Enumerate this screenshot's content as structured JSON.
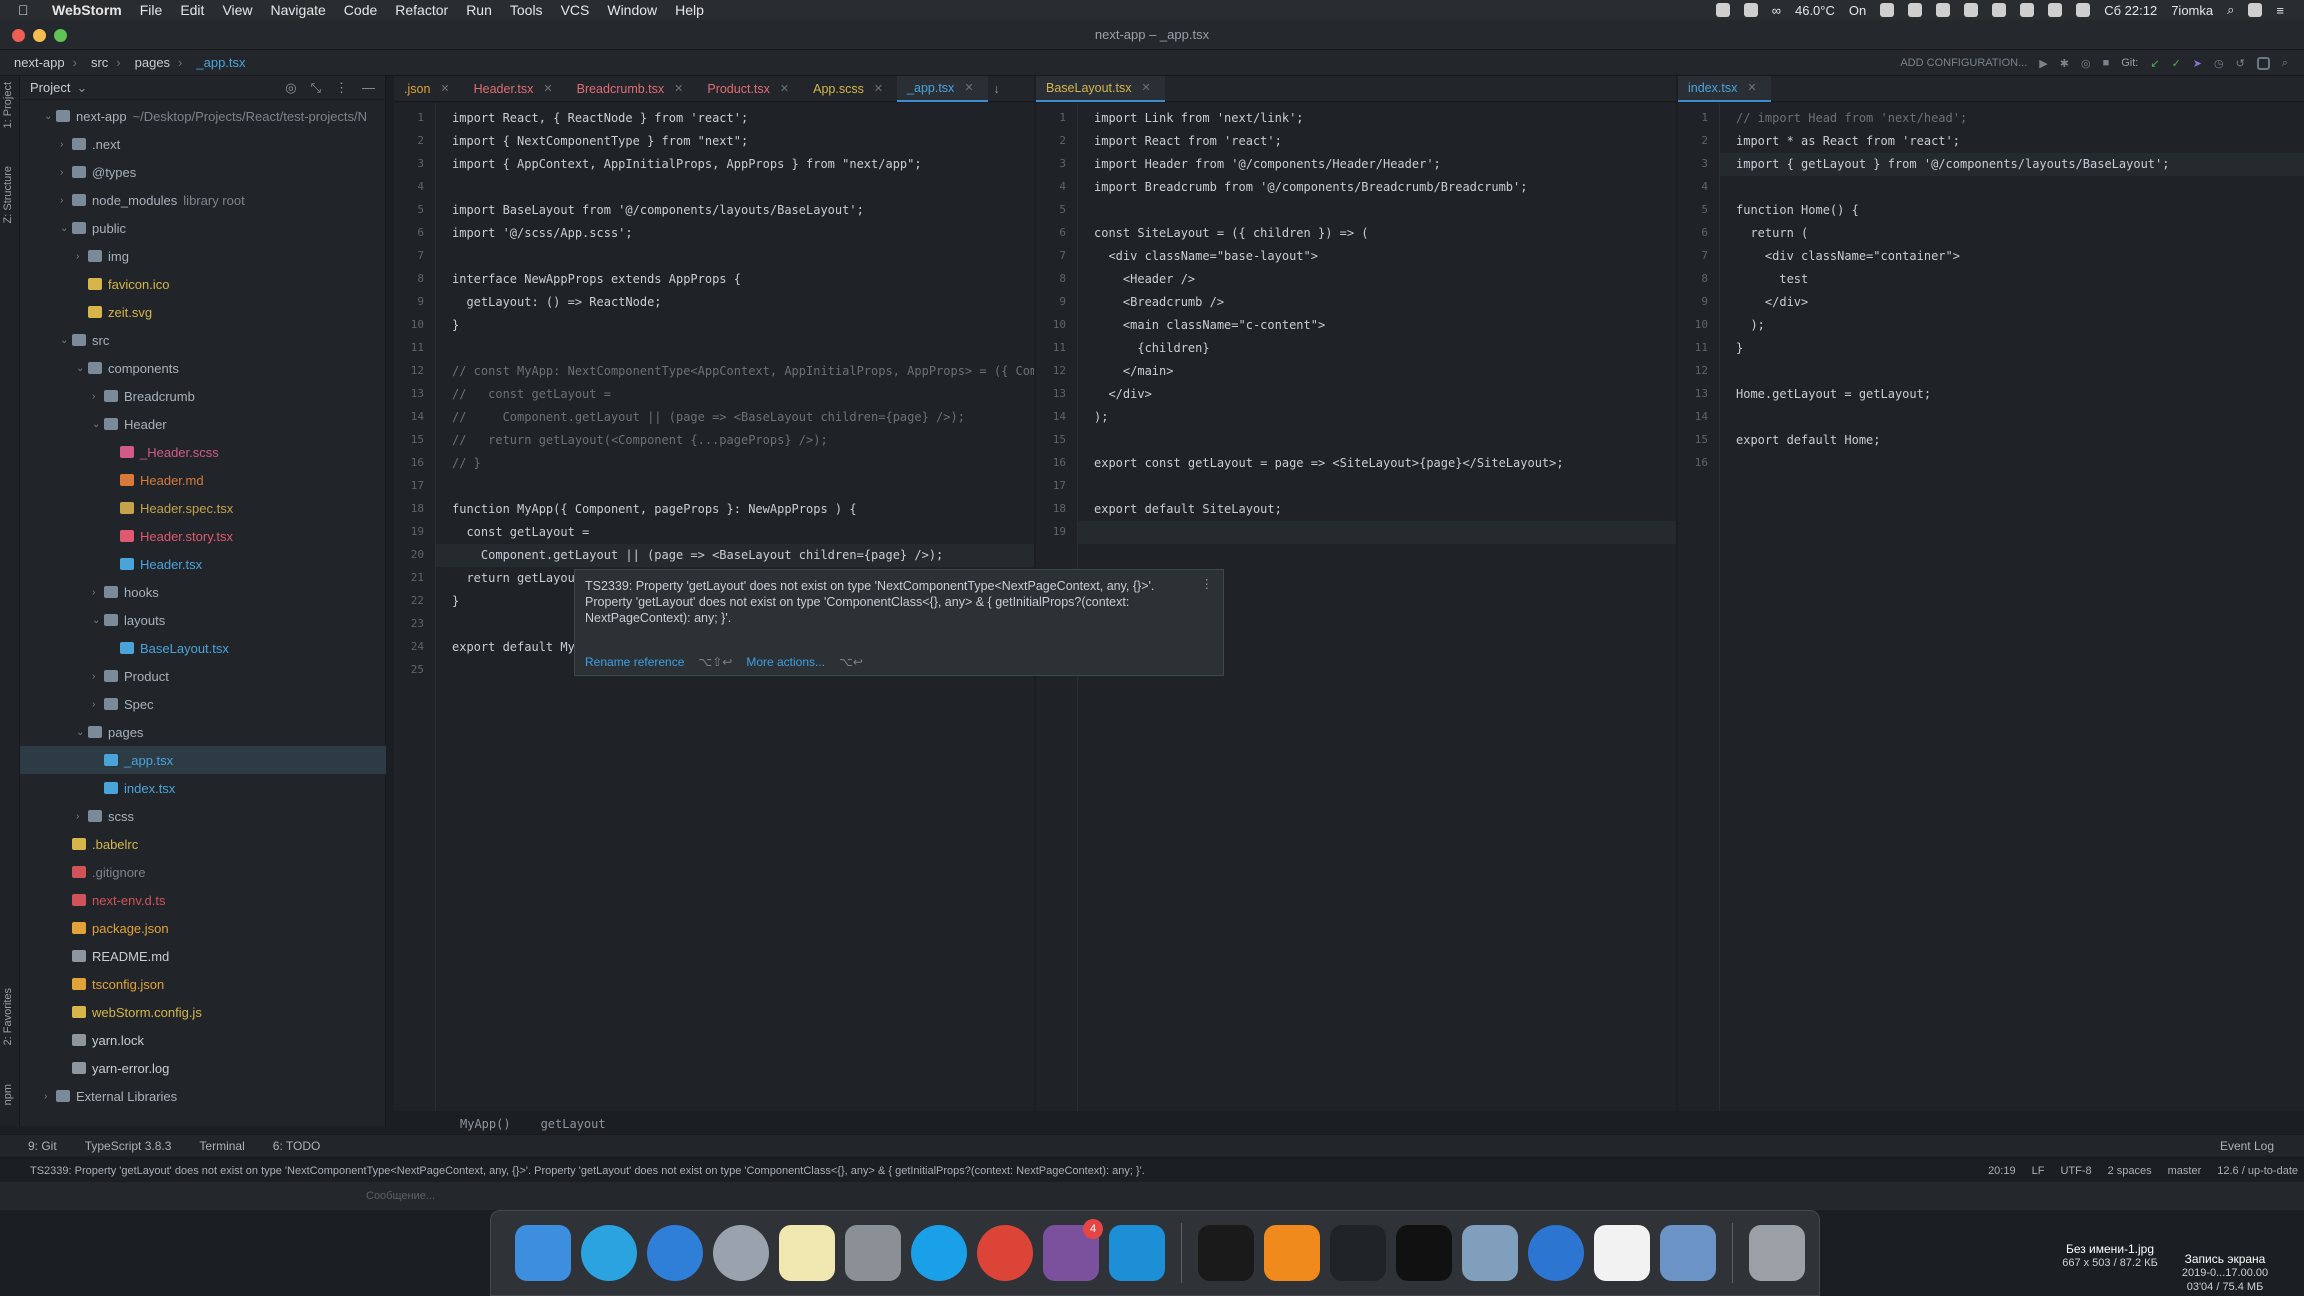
{
  "menubar": {
    "apple": "",
    "app": "WebStorm",
    "items": [
      "File",
      "Edit",
      "View",
      "Navigate",
      "Code",
      "Refactor",
      "Run",
      "Tools",
      "VCS",
      "Window",
      "Help"
    ],
    "status": {
      "temp": "46.0°C",
      "power": "On",
      "datetime": "Сб 22:12",
      "user": "7iomka"
    }
  },
  "window": {
    "title": "next-app – _app.tsx"
  },
  "navbar": {
    "crumbs": [
      "next-app",
      "src",
      "pages",
      "_app.tsx"
    ],
    "add_configuration": "ADD CONFIGURATION...",
    "git_label": "Git:"
  },
  "left_stripe": {
    "project": "1: Project",
    "structure": "Z: Structure",
    "favorites": "2: Favorites",
    "npm": "npm"
  },
  "project_panel": {
    "title": "Project",
    "root": "next-app",
    "root_path": "~/Desktop/Projects/React/test-projects/N",
    "items": [
      {
        "label": "next-app",
        "extra": "~/Desktop/Projects/React/test-projects/N",
        "type": "folder"
      },
      {
        "label": ".next",
        "type": "folder"
      },
      {
        "label": "@types",
        "type": "folder"
      },
      {
        "label": "node_modules",
        "extra": "library root",
        "type": "folder"
      },
      {
        "label": "public",
        "type": "folder"
      },
      {
        "label": "img",
        "type": "folder"
      },
      {
        "label": "favicon.ico",
        "type": "ico"
      },
      {
        "label": "zeit.svg",
        "type": "svg"
      },
      {
        "label": "src",
        "type": "folder"
      },
      {
        "label": "components",
        "type": "folder"
      },
      {
        "label": "Breadcrumb",
        "type": "folder"
      },
      {
        "label": "Header",
        "type": "folder"
      },
      {
        "label": "_Header.scss",
        "type": "scss"
      },
      {
        "label": "Header.md",
        "type": "md"
      },
      {
        "label": "Header.spec.tsx",
        "type": "spec"
      },
      {
        "label": "Header.story.tsx",
        "type": "story"
      },
      {
        "label": "Header.tsx",
        "type": "tsx"
      },
      {
        "label": "hooks",
        "type": "folder"
      },
      {
        "label": "layouts",
        "type": "folder"
      },
      {
        "label": "BaseLayout.tsx",
        "type": "tsx"
      },
      {
        "label": "Product",
        "type": "folder"
      },
      {
        "label": "Spec",
        "type": "folder"
      },
      {
        "label": "pages",
        "type": "folder"
      },
      {
        "label": "_app.tsx",
        "type": "tsx"
      },
      {
        "label": "index.tsx",
        "type": "tsx"
      },
      {
        "label": "scss",
        "type": "folder"
      },
      {
        "label": ".babelrc",
        "type": "yellow"
      },
      {
        "label": ".gitignore",
        "type": "dim"
      },
      {
        "label": "next-env.d.ts",
        "type": "red"
      },
      {
        "label": "package.json",
        "type": "json"
      },
      {
        "label": "README.md",
        "type": "white"
      },
      {
        "label": "tsconfig.json",
        "type": "json"
      },
      {
        "label": "webStorm.config.js",
        "type": "yellow"
      },
      {
        "label": "yarn.lock",
        "type": "white"
      },
      {
        "label": "yarn-error.log",
        "type": "white"
      },
      {
        "label": "External Libraries",
        "type": "folder"
      }
    ]
  },
  "tabs_left": [
    {
      "label": ".json",
      "active": false
    },
    {
      "label": "Header.tsx",
      "active": false
    },
    {
      "label": "Breadcrumb.tsx",
      "active": false
    },
    {
      "label": "Product.tsx",
      "active": false
    },
    {
      "label": "App.scss",
      "active": false
    },
    {
      "label": "_app.tsx",
      "active": true
    }
  ],
  "tabs_middle": [
    {
      "label": "BaseLayout.tsx",
      "active": true
    }
  ],
  "tabs_right": [
    {
      "label": "index.tsx",
      "active": true
    }
  ],
  "editor_left": {
    "lines": [
      "import React, { ReactNode } from 'react';",
      "import { NextComponentType } from \"next\";",
      "import { AppContext, AppInitialProps, AppProps } from \"next/app\";",
      "",
      "import BaseLayout from '@/components/layouts/BaseLayout';",
      "import '@/scss/App.scss';",
      "",
      "interface NewAppProps extends AppProps {",
      "  getLayout: () => ReactNode;",
      "}",
      "",
      "// const MyApp: NextComponentType<AppContext, AppInitialProps, AppProps> = ({ Compo",
      "//   const getLayout =",
      "//     Component.getLayout || (page => <BaseLayout children={page} />);",
      "//   return getLayout(<Component {...pageProps} />);",
      "// }",
      "",
      "function MyApp({ Component, pageProps }: NewAppProps ) {",
      "  const getLayout =",
      "    Component.getLayout || (page => <BaseLayout children={page} />);",
      "  return getLayou",
      "}",
      "",
      "export default My",
      ""
    ]
  },
  "editor_middle": {
    "lines": [
      "import Link from 'next/link';",
      "import React from 'react';",
      "import Header from '@/components/Header/Header';",
      "import Breadcrumb from '@/components/Breadcrumb/Breadcrumb';",
      "",
      "const SiteLayout = ({ children }) => (",
      "  <div className=\"base-layout\">",
      "    <Header />",
      "    <Breadcrumb />",
      "    <main className=\"c-content\">",
      "      {children}",
      "    </main>",
      "  </div>",
      ");",
      "",
      "export const getLayout = page => <SiteLayout>{page}</SiteLayout>;",
      "",
      "export default SiteLayout;",
      ""
    ]
  },
  "editor_right": {
    "lines": [
      "// import Head from 'next/head';",
      "import * as React from 'react';",
      "import { getLayout } from '@/components/layouts/BaseLayout';",
      "",
      "function Home() {",
      "  return (",
      "    <div className=\"container\">",
      "      test",
      "    </div>",
      "  );",
      "}",
      "",
      "Home.getLayout = getLayout;",
      "",
      "export default Home;",
      ""
    ]
  },
  "popup": {
    "message": "TS2339: Property 'getLayout' does not exist on type 'NextComponentType<NextPageContext, any, {}>'.\n  Property 'getLayout' does not exist on type 'ComponentClass<{}, any> & { getInitialProps?(context: NextPageContext): any; }'.",
    "action1": "Rename reference",
    "key1": "⌥⇧↩",
    "action2": "More actions...",
    "key2": "⌥↩"
  },
  "editor_breadcrumb": [
    "MyApp()",
    "getLayout"
  ],
  "toolwindows": {
    "git": "9: Git",
    "typescript": "TypeScript 3.8.3",
    "terminal": "Terminal",
    "todo": "6: TODO",
    "event_log": "Event Log"
  },
  "statusbar": {
    "message": "TS2339: Property 'getLayout' does not exist on type 'NextComponentType<NextPageContext, any, {}>'.  Property 'getLayout' does not exist on type 'ComponentClass<{}, any> & { getInitialProps?(context: NextPageContext): any; }'.",
    "position": "20:19",
    "line_sep": "LF",
    "encoding": "UTF-8",
    "indent": "2 spaces",
    "branch": "master",
    "memory": "12.6 / up-to-date"
  },
  "chat": {
    "placeholder": "Сообщение..."
  },
  "dock": {
    "viber_badge": "4"
  },
  "desktop": {
    "file1_name": "Без имени-1.jpg",
    "file1_info": "667 x 503 / 87.2 КБ",
    "file2_name": "Запись экрана",
    "file2_info": "2019-0...17.00.00",
    "file2_info2": "03'04 / 75.4 МБ"
  },
  "colors": {
    "accent": "#3f8bd0",
    "error": "#cf5358",
    "keyword": "#cc7832",
    "string": "#9fca6b"
  }
}
